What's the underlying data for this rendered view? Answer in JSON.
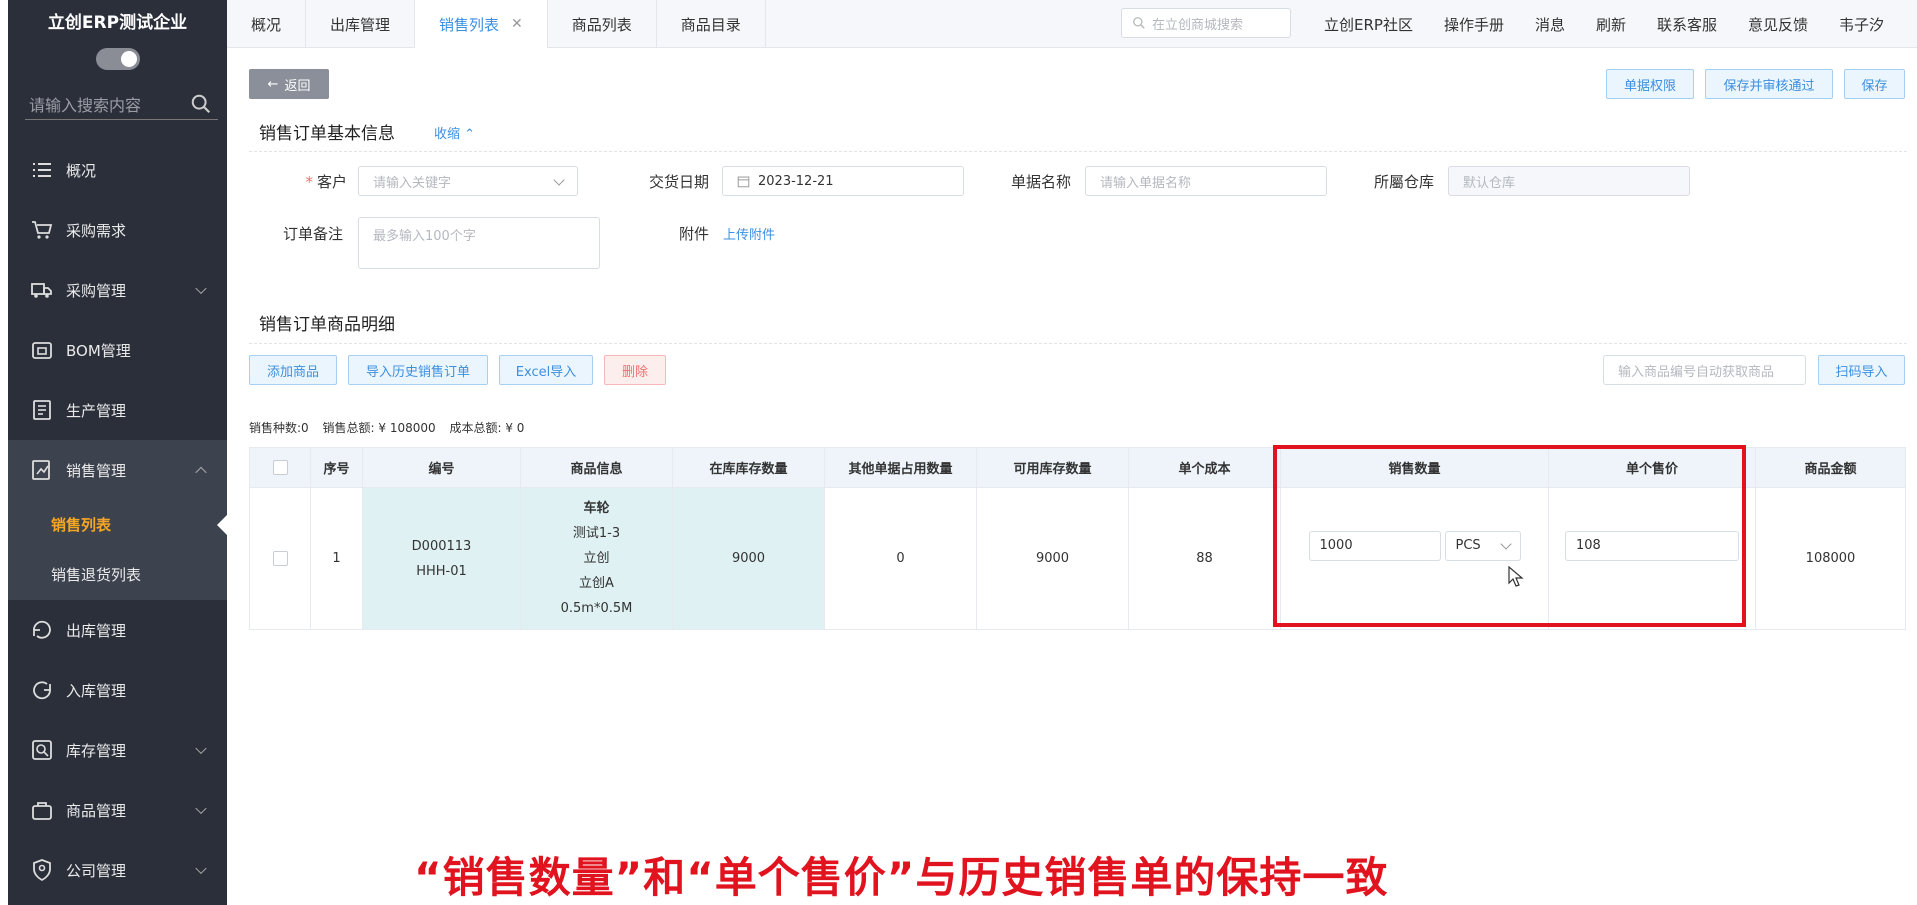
{
  "sidebar": {
    "company": "立创ERP测试企业",
    "search_placeholder": "请输入搜索内容",
    "items": [
      {
        "label": "概况",
        "icon": "list-icon"
      },
      {
        "label": "采购需求",
        "icon": "cart-icon"
      },
      {
        "label": "采购管理",
        "icon": "truck-icon"
      },
      {
        "label": "BOM管理",
        "icon": "box-icon"
      },
      {
        "label": "生产管理",
        "icon": "form-icon"
      },
      {
        "label": "销售管理",
        "icon": "sales-icon"
      },
      {
        "label": "出库管理",
        "icon": "outbound-icon"
      },
      {
        "label": "入库管理",
        "icon": "inbound-icon"
      },
      {
        "label": "库存管理",
        "icon": "stock-icon"
      },
      {
        "label": "商品管理",
        "icon": "goods-icon"
      },
      {
        "label": "公司管理",
        "icon": "shield-icon"
      }
    ],
    "sales_sub": [
      "销售列表",
      "销售退货列表"
    ]
  },
  "topbar": {
    "tabs": [
      "概况",
      "出库管理",
      "销售列表",
      "商品列表",
      "商品目录"
    ],
    "active_tab": "销售列表",
    "search_placeholder": "在立创商城搜索",
    "links": [
      "立创ERP社区",
      "操作手册",
      "消息",
      "刷新",
      "联系客服",
      "意见反馈",
      "韦子汐"
    ]
  },
  "actions": {
    "back": "返回",
    "permission": "单据权限",
    "save_approve": "保存并审核通过",
    "save": "保存"
  },
  "basic_info": {
    "title": "销售订单基本信息",
    "collapse": "收缩",
    "customer_label": "客户",
    "customer_placeholder": "请输入关键字",
    "delivery_date_label": "交货日期",
    "delivery_date": "2023-12-21",
    "doc_name_label": "单据名称",
    "doc_name_placeholder": "请输入单据名称",
    "warehouse_label": "所屬仓库",
    "warehouse_placeholder": "默认仓库",
    "remark_label": "订单备注",
    "remark_placeholder": "最多输入100个字",
    "attachment_label": "附件",
    "attachment_link": "上传附件"
  },
  "detail": {
    "title": "销售订单商品明细",
    "btn_add": "添加商品",
    "btn_import_history": "导入历史销售订单",
    "btn_excel": "Excel导入",
    "btn_delete": "删除",
    "code_placeholder": "输入商品编号自动获取商品",
    "btn_scan": "扫码导入",
    "summary": {
      "kinds": "销售种数:0",
      "total": "销售总额: ¥ 108000",
      "cost": "成本总额: ¥ 0"
    },
    "columns": [
      "序号",
      "编号",
      "商品信息",
      "在库库存数量",
      "其他单据占用数量",
      "可用库存数量",
      "单个成本",
      "销售数量",
      "单个售价",
      "商品金额"
    ],
    "row": {
      "index": "1",
      "code1": "D000113",
      "code2": "HHH-01",
      "info": [
        "车轮",
        "测试1-3",
        "立创",
        "立创A",
        "0.5m*0.5M"
      ],
      "stock": "9000",
      "occupied": "0",
      "available": "9000",
      "unit_cost": "88",
      "qty": "1000",
      "unit": "PCS",
      "price": "108",
      "amount": "108000"
    }
  },
  "caption": "“销售数量”和“单个售价”与历史销售单的保持一致",
  "colors": {
    "accent": "#3d8fe0",
    "highlight": "#e0131e",
    "sidebar": "#2b2f3a"
  }
}
